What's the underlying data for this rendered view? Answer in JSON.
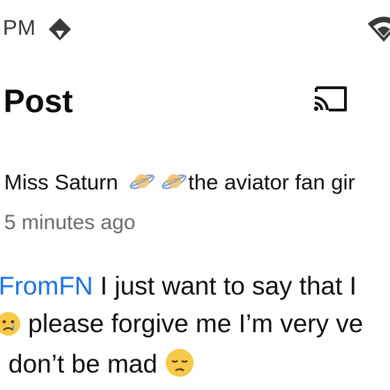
{
  "status_bar": {
    "time": "PM",
    "icons": [
      "drive-icon",
      "wifi-icon"
    ]
  },
  "header": {
    "title": "Post",
    "cast_icon": "cast-icon"
  },
  "post": {
    "author": "Miss Saturn",
    "author_suffix": "the aviator fan gir",
    "author_emojis": [
      "ringed-planet-emoji",
      "ringed-planet-emoji"
    ],
    "time_ago": "5 minutes ago",
    "body": {
      "mention": "FromFN",
      "line1_text": " I just want to say that I",
      "line2_text": " please forgive me I’m very ve",
      "line3_text": "don’t be mad ",
      "emojis": [
        "sad-face-emoji",
        "pensive-face-emoji"
      ]
    }
  },
  "colors": {
    "link": "#1a73e8",
    "text": "#111111",
    "muted": "#6b6b6b",
    "background": "#ffffff"
  }
}
